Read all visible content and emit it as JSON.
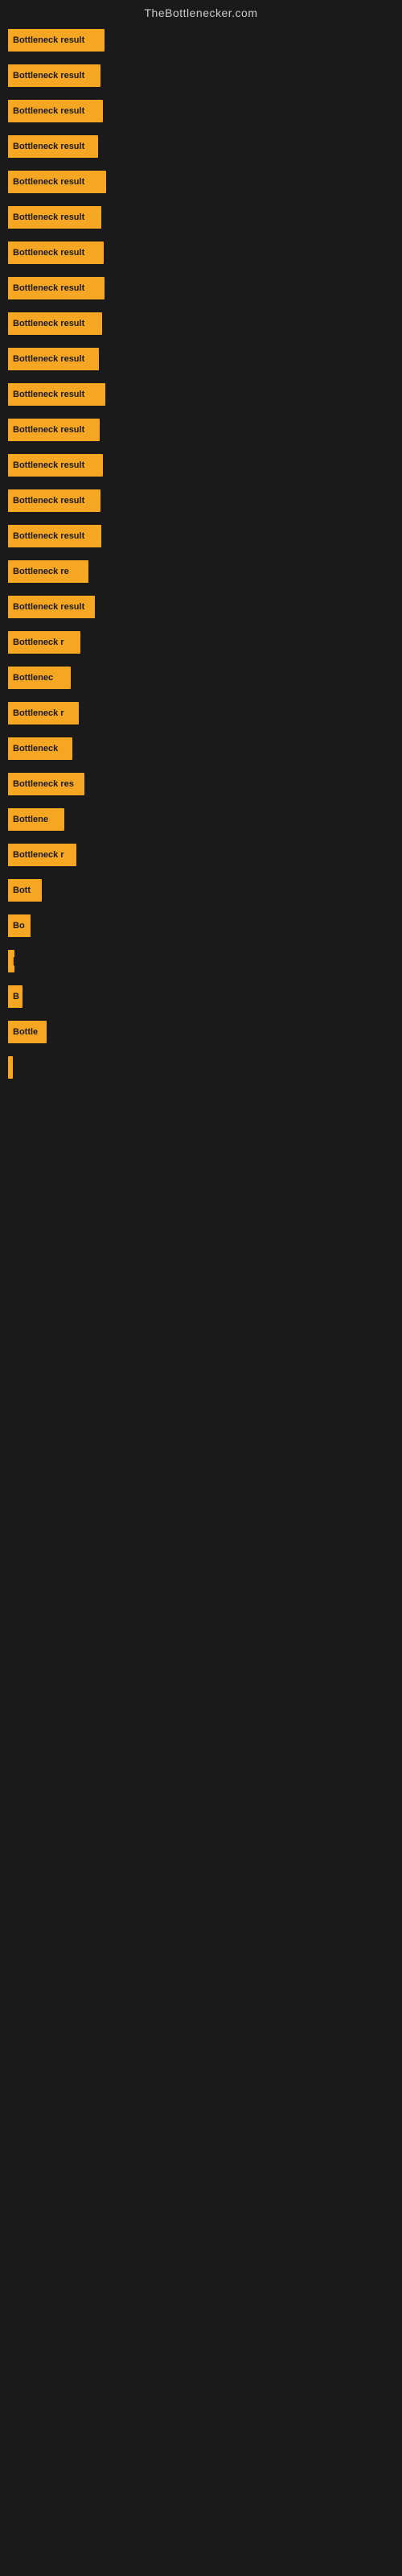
{
  "site_title": "TheBottlenecker.com",
  "bars": [
    {
      "label": "Bottleneck result",
      "width": 120
    },
    {
      "label": "Bottleneck result",
      "width": 115
    },
    {
      "label": "Bottleneck result",
      "width": 118
    },
    {
      "label": "Bottleneck result",
      "width": 112
    },
    {
      "label": "Bottleneck result",
      "width": 122
    },
    {
      "label": "Bottleneck result",
      "width": 116
    },
    {
      "label": "Bottleneck result",
      "width": 119
    },
    {
      "label": "Bottleneck result",
      "width": 120
    },
    {
      "label": "Bottleneck result",
      "width": 117
    },
    {
      "label": "Bottleneck result",
      "width": 113
    },
    {
      "label": "Bottleneck result",
      "width": 121
    },
    {
      "label": "Bottleneck result",
      "width": 114
    },
    {
      "label": "Bottleneck result",
      "width": 118
    },
    {
      "label": "Bottleneck result",
      "width": 115
    },
    {
      "label": "Bottleneck result",
      "width": 116
    },
    {
      "label": "Bottleneck re",
      "width": 100
    },
    {
      "label": "Bottleneck result",
      "width": 108
    },
    {
      "label": "Bottleneck r",
      "width": 90
    },
    {
      "label": "Bottlenec",
      "width": 78
    },
    {
      "label": "Bottleneck r",
      "width": 88
    },
    {
      "label": "Bottleneck",
      "width": 80
    },
    {
      "label": "Bottleneck res",
      "width": 95
    },
    {
      "label": "Bottlene",
      "width": 70
    },
    {
      "label": "Bottleneck r",
      "width": 85
    },
    {
      "label": "Bott",
      "width": 42
    },
    {
      "label": "Bo",
      "width": 28
    },
    {
      "label": "|",
      "width": 8
    },
    {
      "label": "B",
      "width": 18
    },
    {
      "label": "Bottle",
      "width": 48
    },
    {
      "label": "|",
      "width": 6
    }
  ]
}
